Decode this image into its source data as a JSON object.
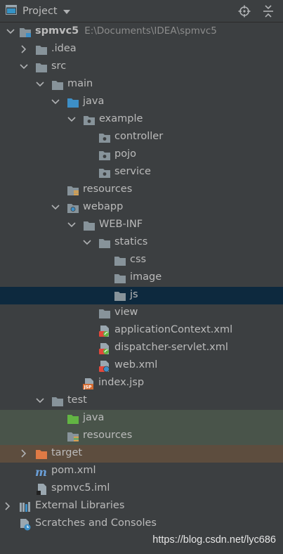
{
  "header": {
    "title": "Project"
  },
  "tree": {
    "root_name": "spmvc5",
    "root_path": "E:\\Documents\\IDEA\\spmvc5",
    "idea": ".idea",
    "src": "src",
    "main": "main",
    "java": "java",
    "example": "example",
    "controller": "controller",
    "pojo": "pojo",
    "service": "service",
    "resources": "resources",
    "webapp": "webapp",
    "webinf": "WEB-INF",
    "statics": "statics",
    "css": "css",
    "image": "image",
    "js": "js",
    "view": "view",
    "app_context": "applicationContext.xml",
    "dispatcher": "dispatcher-servlet.xml",
    "web_xml": "web.xml",
    "index_jsp": "index.jsp",
    "test": "test",
    "test_java": "java",
    "test_resources": "resources",
    "target": "target",
    "pom": "pom.xml",
    "iml": "spmvc5.iml",
    "ext_libs": "External Libraries",
    "scratches": "Scratches and Consoles"
  },
  "watermark": "https://blog.csdn.net/lyc686",
  "colors": {
    "background": "#3c3f41",
    "selected_row": "#0d293e",
    "test_row": "#49544a",
    "excluded_row": "#5d4d3e",
    "folder_gray": "#87939a",
    "folder_blue": "#3d8fc7",
    "folder_green": "#62b543",
    "folder_orange": "#e07a45"
  }
}
